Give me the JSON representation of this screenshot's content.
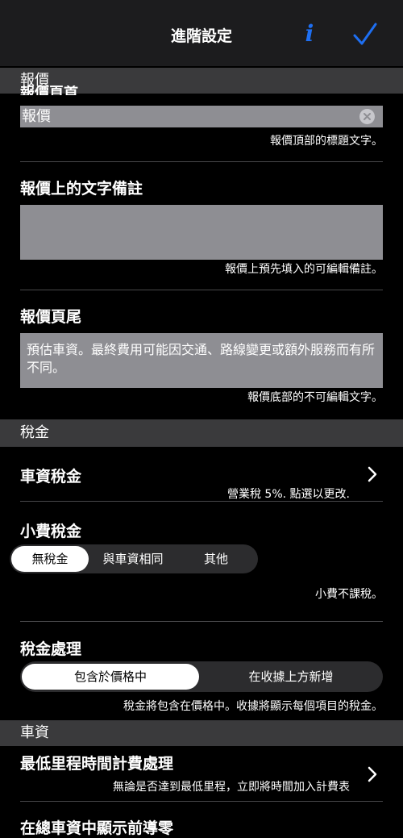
{
  "nav": {
    "title": "進階設定"
  },
  "sections": {
    "quote": "報價",
    "tax": "稅金",
    "fare": "車資"
  },
  "quote_title": {
    "label": "報價頁首",
    "value": "報價",
    "hint": "報價頂部的標題文字。"
  },
  "quote_note": {
    "label": "報價上的文字備註",
    "value": "",
    "hint": "報價上預先填入的可編輯備註。"
  },
  "quote_footer": {
    "label": "報價頁尾",
    "value": "預估車資。最終費用可能因交通、路線變更或額外服務而有所不同。",
    "hint": "報價底部的不可編輯文字。"
  },
  "fare_tax": {
    "label": "車資稅金",
    "hint": "營業稅 5%. 點選以更改."
  },
  "tip_tax": {
    "label": "小費稅金",
    "options": [
      "無稅金",
      "與車資相同",
      "其他"
    ],
    "selected": "無稅金",
    "hint": "小費不課稅。"
  },
  "tax_handling": {
    "label": "稅金處理",
    "options": [
      "包含於價格中",
      "在收據上方新增"
    ],
    "selected": "包含於價格中",
    "hint": "稅金將包含在價格中。收據將顯示每個項目的稅金。"
  },
  "min_fare": {
    "label": "最低里程時間計費處理",
    "hint": "無論是否達到最低里程，立即將時間加入計費表"
  },
  "show_rounding": {
    "label": "在總車資中顯示前導零"
  },
  "colors": {
    "accent": "#1e6ff2",
    "section_bg": "#3a3a3c",
    "field_bg": "#8e8e93"
  }
}
